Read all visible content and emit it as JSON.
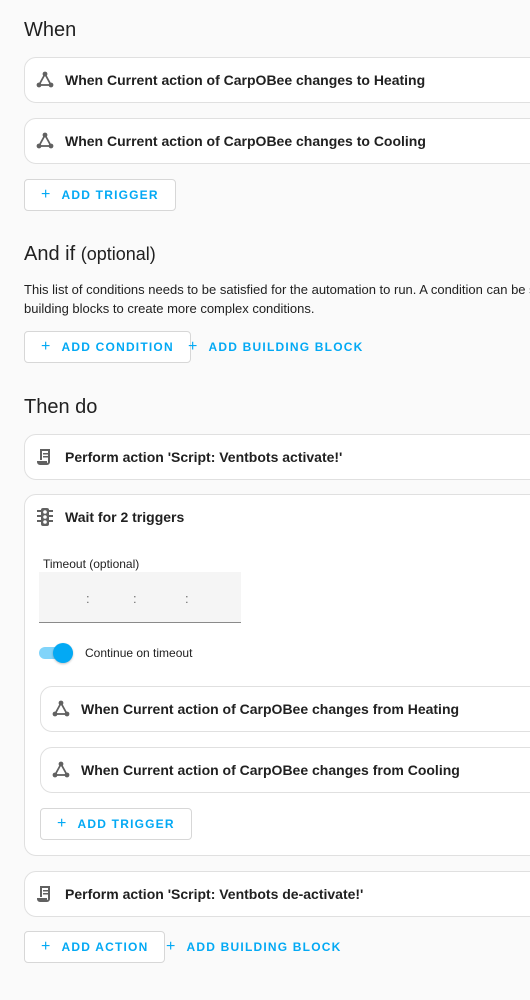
{
  "when": {
    "title": "When",
    "triggers": [
      "When Current action of CarpOBee changes to Heating",
      "When Current action of CarpOBee changes to Cooling"
    ],
    "add_trigger_label": "ADD TRIGGER"
  },
  "and_if": {
    "title": "And if",
    "optional": "(optional)",
    "description_line1": "This list of conditions needs to be satisfied for the automation to run. A condition can be s",
    "description_line2": "building blocks to create more complex conditions.",
    "add_condition_label": "ADD CONDITION",
    "add_building_block_label": "ADD BUILDING BLOCK"
  },
  "then_do": {
    "title": "Then do",
    "action1": "Perform action 'Script: Ventbots activate!'",
    "wait": {
      "title": "Wait for 2 triggers",
      "timeout_label": "Timeout (optional)",
      "timeout_separator": ":",
      "continue_label": "Continue on timeout",
      "continue_on": true,
      "triggers": [
        "When Current action of CarpOBee changes from Heating",
        "When Current action of CarpOBee changes from Cooling"
      ],
      "add_trigger_label": "ADD TRIGGER"
    },
    "action2": "Perform action 'Script: Ventbots de-activate!'",
    "add_action_label": "ADD ACTION",
    "add_building_block_label": "ADD BUILDING BLOCK"
  },
  "colors": {
    "accent": "#03a9f4",
    "icon": "#616161",
    "card_border": "#e0e0e0"
  },
  "icons": {
    "trigger": "trigger-graph-icon",
    "script": "script-scroll-icon",
    "wait": "traffic-light-icon",
    "add": "plus-icon"
  }
}
